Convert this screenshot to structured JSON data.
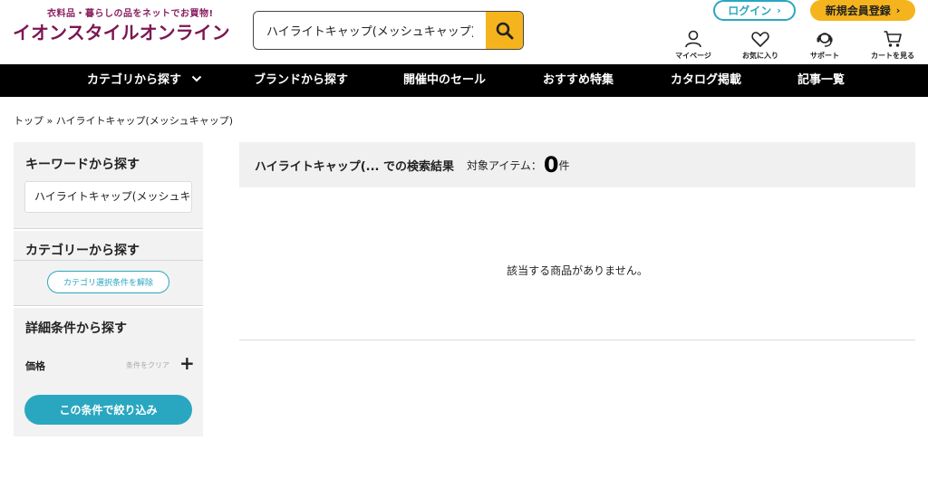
{
  "header": {
    "tagline": "衣料品・暮らしの品をネットでお買物!",
    "logo": "イオンスタイルオンライン",
    "search_value": "ハイライトキャップ(メッシュキャップ)",
    "login_label": "ログイン",
    "register_label": "新規会員登録",
    "util": {
      "mypage": "マイページ",
      "favorites": "お気に入り",
      "support": "サポート",
      "cart": "カートを見る"
    }
  },
  "nav": {
    "items": [
      "カテゴリから探す",
      "ブランドから探す",
      "開催中のセール",
      "おすすめ特集",
      "カタログ掲載",
      "記事一覧"
    ]
  },
  "breadcrumb": {
    "home": "トップ",
    "separator": "»",
    "current": "ハイライトキャップ(メッシュキャップ)"
  },
  "sidebar": {
    "keyword_title": "キーワードから探す",
    "keyword_value": "ハイライトキャップ(メッシュキャップ)",
    "category_title": "カテゴリーから探す",
    "category_clear": "カテゴリ選択条件を解除",
    "detail_title": "詳細条件から探す",
    "price_label": "価格",
    "price_clear": "条件をクリア",
    "price_toggle": "+",
    "filter_button": "この条件で絞り込み"
  },
  "results": {
    "query": "ハイライトキャップ(... での検索結果",
    "target_label": "対象アイテム：",
    "count": "0",
    "unit": "件",
    "empty_message": "該当する商品がありません。"
  },
  "colors": {
    "brand": "#7b1752",
    "accent_yellow": "#f5b41e",
    "accent_teal": "#2aa7c0",
    "nav_bg": "#000000"
  }
}
